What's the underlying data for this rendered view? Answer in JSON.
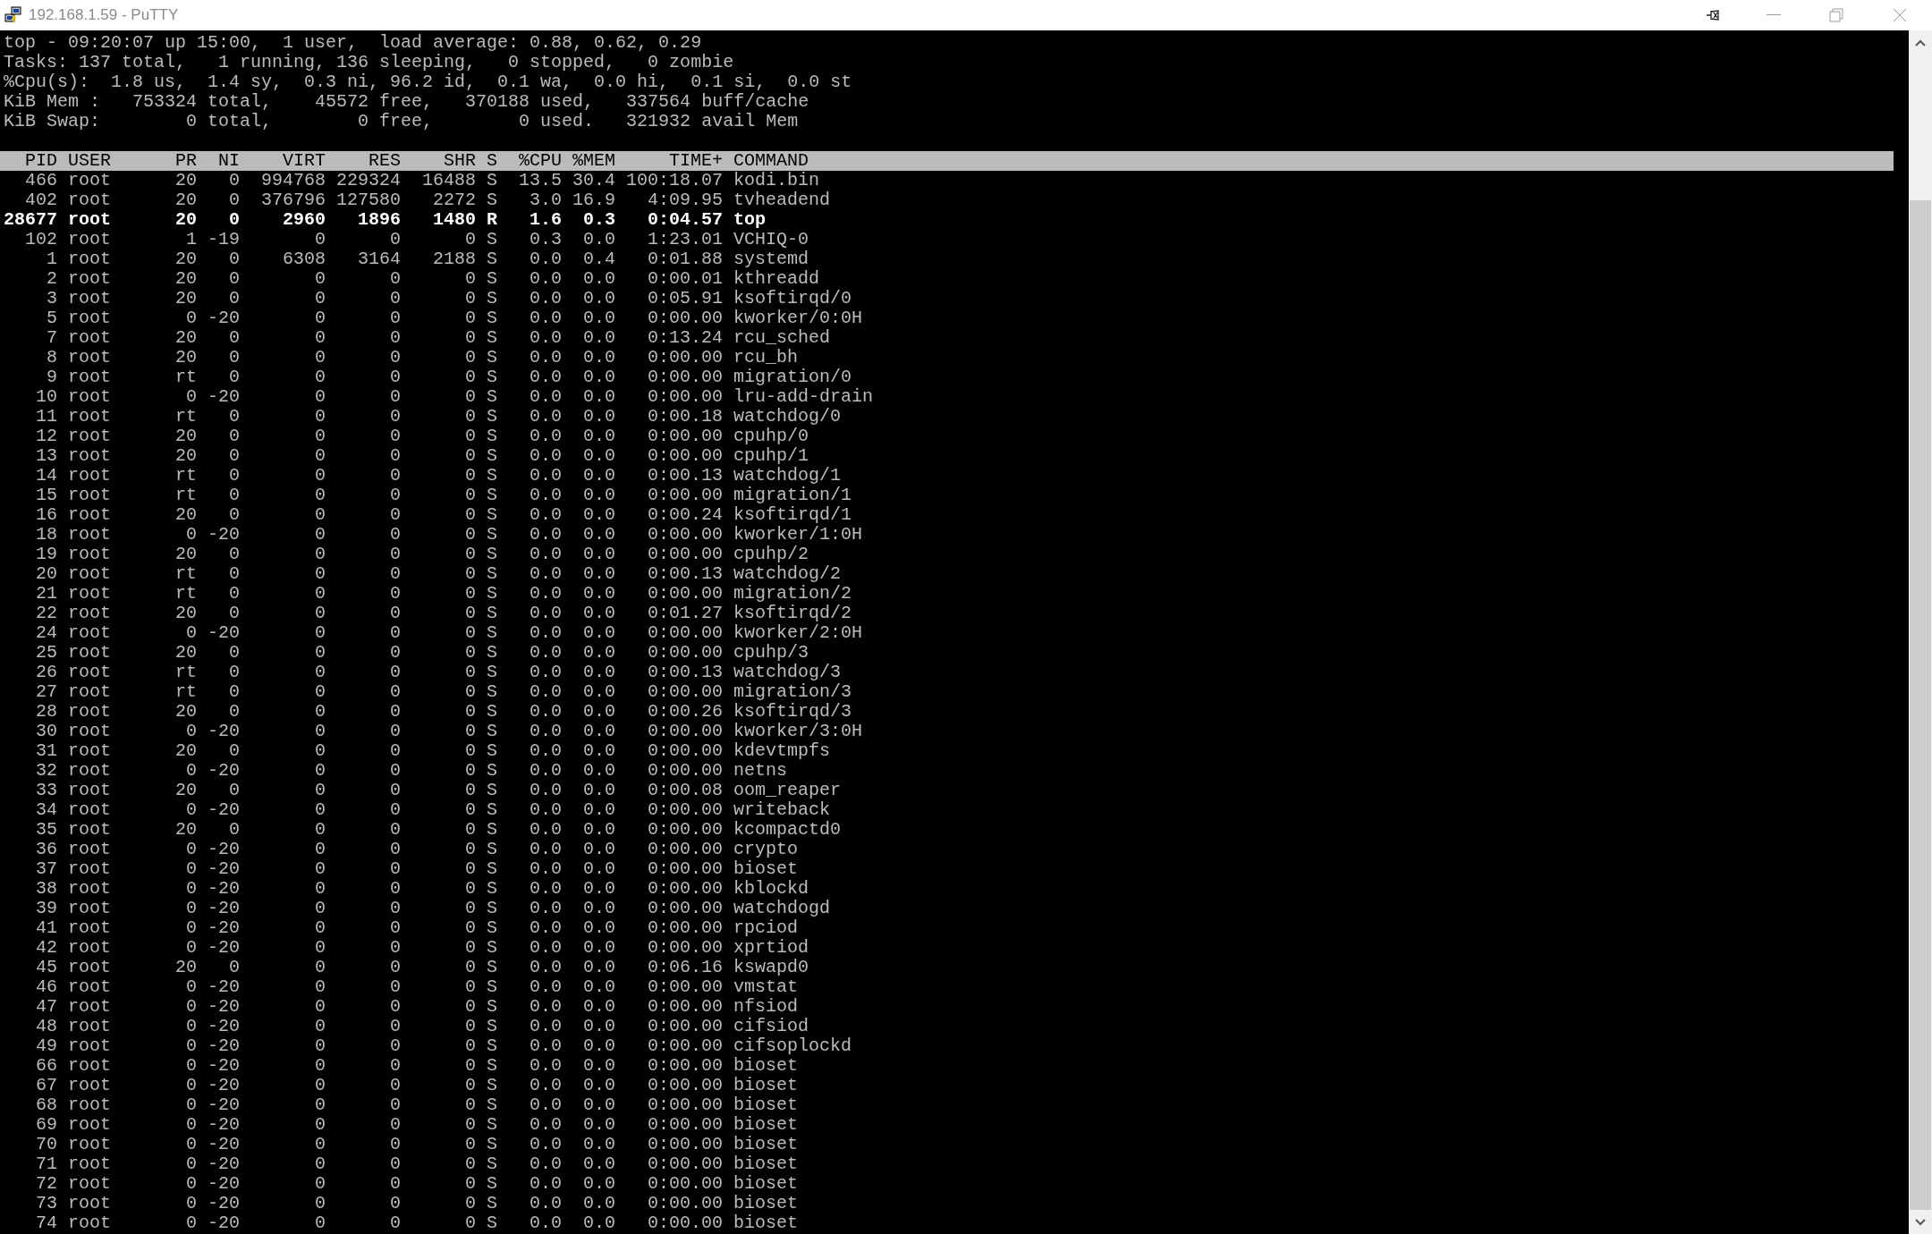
{
  "window": {
    "title": "192.168.1.59 - PuTTY"
  },
  "summary": [
    "top - 09:20:07 up 15:00,  1 user,  load average: 0.88, 0.62, 0.29",
    "Tasks: 137 total,   1 running, 136 sleeping,   0 stopped,   0 zombie",
    "%Cpu(s):  1.8 us,  1.4 sy,  0.3 ni, 96.2 id,  0.1 wa,  0.0 hi,  0.1 si,  0.0 st",
    "KiB Mem :   753324 total,    45572 free,   370188 used,   337564 buff/cache",
    "KiB Swap:        0 total,        0 free,        0 used.   321932 avail Mem"
  ],
  "table": {
    "columns": [
      "PID",
      "USER",
      "PR",
      "NI",
      "VIRT",
      "RES",
      "SHR",
      "S",
      "%CPU",
      "%MEM",
      "TIME+",
      "COMMAND"
    ],
    "rows": [
      {
        "cells": [
          "466",
          "root",
          "20",
          "0",
          "994768",
          "229324",
          "16488",
          "S",
          "13.5",
          "30.4",
          "100:18.07",
          "kodi.bin"
        ],
        "running": false
      },
      {
        "cells": [
          "402",
          "root",
          "20",
          "0",
          "376796",
          "127580",
          "2272",
          "S",
          "3.0",
          "16.9",
          "4:09.95",
          "tvheadend"
        ],
        "running": false
      },
      {
        "cells": [
          "28677",
          "root",
          "20",
          "0",
          "2960",
          "1896",
          "1480",
          "R",
          "1.6",
          "0.3",
          "0:04.57",
          "top"
        ],
        "running": true
      },
      {
        "cells": [
          "102",
          "root",
          "1",
          "-19",
          "0",
          "0",
          "0",
          "S",
          "0.3",
          "0.0",
          "1:23.01",
          "VCHIQ-0"
        ],
        "running": false
      },
      {
        "cells": [
          "1",
          "root",
          "20",
          "0",
          "6308",
          "3164",
          "2188",
          "S",
          "0.0",
          "0.4",
          "0:01.88",
          "systemd"
        ],
        "running": false
      },
      {
        "cells": [
          "2",
          "root",
          "20",
          "0",
          "0",
          "0",
          "0",
          "S",
          "0.0",
          "0.0",
          "0:00.01",
          "kthreadd"
        ],
        "running": false
      },
      {
        "cells": [
          "3",
          "root",
          "20",
          "0",
          "0",
          "0",
          "0",
          "S",
          "0.0",
          "0.0",
          "0:05.91",
          "ksoftirqd/0"
        ],
        "running": false
      },
      {
        "cells": [
          "5",
          "root",
          "0",
          "-20",
          "0",
          "0",
          "0",
          "S",
          "0.0",
          "0.0",
          "0:00.00",
          "kworker/0:0H"
        ],
        "running": false
      },
      {
        "cells": [
          "7",
          "root",
          "20",
          "0",
          "0",
          "0",
          "0",
          "S",
          "0.0",
          "0.0",
          "0:13.24",
          "rcu_sched"
        ],
        "running": false
      },
      {
        "cells": [
          "8",
          "root",
          "20",
          "0",
          "0",
          "0",
          "0",
          "S",
          "0.0",
          "0.0",
          "0:00.00",
          "rcu_bh"
        ],
        "running": false
      },
      {
        "cells": [
          "9",
          "root",
          "rt",
          "0",
          "0",
          "0",
          "0",
          "S",
          "0.0",
          "0.0",
          "0:00.00",
          "migration/0"
        ],
        "running": false
      },
      {
        "cells": [
          "10",
          "root",
          "0",
          "-20",
          "0",
          "0",
          "0",
          "S",
          "0.0",
          "0.0",
          "0:00.00",
          "lru-add-drain"
        ],
        "running": false
      },
      {
        "cells": [
          "11",
          "root",
          "rt",
          "0",
          "0",
          "0",
          "0",
          "S",
          "0.0",
          "0.0",
          "0:00.18",
          "watchdog/0"
        ],
        "running": false
      },
      {
        "cells": [
          "12",
          "root",
          "20",
          "0",
          "0",
          "0",
          "0",
          "S",
          "0.0",
          "0.0",
          "0:00.00",
          "cpuhp/0"
        ],
        "running": false
      },
      {
        "cells": [
          "13",
          "root",
          "20",
          "0",
          "0",
          "0",
          "0",
          "S",
          "0.0",
          "0.0",
          "0:00.00",
          "cpuhp/1"
        ],
        "running": false
      },
      {
        "cells": [
          "14",
          "root",
          "rt",
          "0",
          "0",
          "0",
          "0",
          "S",
          "0.0",
          "0.0",
          "0:00.13",
          "watchdog/1"
        ],
        "running": false
      },
      {
        "cells": [
          "15",
          "root",
          "rt",
          "0",
          "0",
          "0",
          "0",
          "S",
          "0.0",
          "0.0",
          "0:00.00",
          "migration/1"
        ],
        "running": false
      },
      {
        "cells": [
          "16",
          "root",
          "20",
          "0",
          "0",
          "0",
          "0",
          "S",
          "0.0",
          "0.0",
          "0:00.24",
          "ksoftirqd/1"
        ],
        "running": false
      },
      {
        "cells": [
          "18",
          "root",
          "0",
          "-20",
          "0",
          "0",
          "0",
          "S",
          "0.0",
          "0.0",
          "0:00.00",
          "kworker/1:0H"
        ],
        "running": false
      },
      {
        "cells": [
          "19",
          "root",
          "20",
          "0",
          "0",
          "0",
          "0",
          "S",
          "0.0",
          "0.0",
          "0:00.00",
          "cpuhp/2"
        ],
        "running": false
      },
      {
        "cells": [
          "20",
          "root",
          "rt",
          "0",
          "0",
          "0",
          "0",
          "S",
          "0.0",
          "0.0",
          "0:00.13",
          "watchdog/2"
        ],
        "running": false
      },
      {
        "cells": [
          "21",
          "root",
          "rt",
          "0",
          "0",
          "0",
          "0",
          "S",
          "0.0",
          "0.0",
          "0:00.00",
          "migration/2"
        ],
        "running": false
      },
      {
        "cells": [
          "22",
          "root",
          "20",
          "0",
          "0",
          "0",
          "0",
          "S",
          "0.0",
          "0.0",
          "0:01.27",
          "ksoftirqd/2"
        ],
        "running": false
      },
      {
        "cells": [
          "24",
          "root",
          "0",
          "-20",
          "0",
          "0",
          "0",
          "S",
          "0.0",
          "0.0",
          "0:00.00",
          "kworker/2:0H"
        ],
        "running": false
      },
      {
        "cells": [
          "25",
          "root",
          "20",
          "0",
          "0",
          "0",
          "0",
          "S",
          "0.0",
          "0.0",
          "0:00.00",
          "cpuhp/3"
        ],
        "running": false
      },
      {
        "cells": [
          "26",
          "root",
          "rt",
          "0",
          "0",
          "0",
          "0",
          "S",
          "0.0",
          "0.0",
          "0:00.13",
          "watchdog/3"
        ],
        "running": false
      },
      {
        "cells": [
          "27",
          "root",
          "rt",
          "0",
          "0",
          "0",
          "0",
          "S",
          "0.0",
          "0.0",
          "0:00.00",
          "migration/3"
        ],
        "running": false
      },
      {
        "cells": [
          "28",
          "root",
          "20",
          "0",
          "0",
          "0",
          "0",
          "S",
          "0.0",
          "0.0",
          "0:00.26",
          "ksoftirqd/3"
        ],
        "running": false
      },
      {
        "cells": [
          "30",
          "root",
          "0",
          "-20",
          "0",
          "0",
          "0",
          "S",
          "0.0",
          "0.0",
          "0:00.00",
          "kworker/3:0H"
        ],
        "running": false
      },
      {
        "cells": [
          "31",
          "root",
          "20",
          "0",
          "0",
          "0",
          "0",
          "S",
          "0.0",
          "0.0",
          "0:00.00",
          "kdevtmpfs"
        ],
        "running": false
      },
      {
        "cells": [
          "32",
          "root",
          "0",
          "-20",
          "0",
          "0",
          "0",
          "S",
          "0.0",
          "0.0",
          "0:00.00",
          "netns"
        ],
        "running": false
      },
      {
        "cells": [
          "33",
          "root",
          "20",
          "0",
          "0",
          "0",
          "0",
          "S",
          "0.0",
          "0.0",
          "0:00.08",
          "oom_reaper"
        ],
        "running": false
      },
      {
        "cells": [
          "34",
          "root",
          "0",
          "-20",
          "0",
          "0",
          "0",
          "S",
          "0.0",
          "0.0",
          "0:00.00",
          "writeback"
        ],
        "running": false
      },
      {
        "cells": [
          "35",
          "root",
          "20",
          "0",
          "0",
          "0",
          "0",
          "S",
          "0.0",
          "0.0",
          "0:00.00",
          "kcompactd0"
        ],
        "running": false
      },
      {
        "cells": [
          "36",
          "root",
          "0",
          "-20",
          "0",
          "0",
          "0",
          "S",
          "0.0",
          "0.0",
          "0:00.00",
          "crypto"
        ],
        "running": false
      },
      {
        "cells": [
          "37",
          "root",
          "0",
          "-20",
          "0",
          "0",
          "0",
          "S",
          "0.0",
          "0.0",
          "0:00.00",
          "bioset"
        ],
        "running": false
      },
      {
        "cells": [
          "38",
          "root",
          "0",
          "-20",
          "0",
          "0",
          "0",
          "S",
          "0.0",
          "0.0",
          "0:00.00",
          "kblockd"
        ],
        "running": false
      },
      {
        "cells": [
          "39",
          "root",
          "0",
          "-20",
          "0",
          "0",
          "0",
          "S",
          "0.0",
          "0.0",
          "0:00.00",
          "watchdogd"
        ],
        "running": false
      },
      {
        "cells": [
          "41",
          "root",
          "0",
          "-20",
          "0",
          "0",
          "0",
          "S",
          "0.0",
          "0.0",
          "0:00.00",
          "rpciod"
        ],
        "running": false
      },
      {
        "cells": [
          "42",
          "root",
          "0",
          "-20",
          "0",
          "0",
          "0",
          "S",
          "0.0",
          "0.0",
          "0:00.00",
          "xprtiod"
        ],
        "running": false
      },
      {
        "cells": [
          "45",
          "root",
          "20",
          "0",
          "0",
          "0",
          "0",
          "S",
          "0.0",
          "0.0",
          "0:06.16",
          "kswapd0"
        ],
        "running": false
      },
      {
        "cells": [
          "46",
          "root",
          "0",
          "-20",
          "0",
          "0",
          "0",
          "S",
          "0.0",
          "0.0",
          "0:00.00",
          "vmstat"
        ],
        "running": false
      },
      {
        "cells": [
          "47",
          "root",
          "0",
          "-20",
          "0",
          "0",
          "0",
          "S",
          "0.0",
          "0.0",
          "0:00.00",
          "nfsiod"
        ],
        "running": false
      },
      {
        "cells": [
          "48",
          "root",
          "0",
          "-20",
          "0",
          "0",
          "0",
          "S",
          "0.0",
          "0.0",
          "0:00.00",
          "cifsiod"
        ],
        "running": false
      },
      {
        "cells": [
          "49",
          "root",
          "0",
          "-20",
          "0",
          "0",
          "0",
          "S",
          "0.0",
          "0.0",
          "0:00.00",
          "cifsoplockd"
        ],
        "running": false
      },
      {
        "cells": [
          "66",
          "root",
          "0",
          "-20",
          "0",
          "0",
          "0",
          "S",
          "0.0",
          "0.0",
          "0:00.00",
          "bioset"
        ],
        "running": false
      },
      {
        "cells": [
          "67",
          "root",
          "0",
          "-20",
          "0",
          "0",
          "0",
          "S",
          "0.0",
          "0.0",
          "0:00.00",
          "bioset"
        ],
        "running": false
      },
      {
        "cells": [
          "68",
          "root",
          "0",
          "-20",
          "0",
          "0",
          "0",
          "S",
          "0.0",
          "0.0",
          "0:00.00",
          "bioset"
        ],
        "running": false
      },
      {
        "cells": [
          "69",
          "root",
          "0",
          "-20",
          "0",
          "0",
          "0",
          "S",
          "0.0",
          "0.0",
          "0:00.00",
          "bioset"
        ],
        "running": false
      },
      {
        "cells": [
          "70",
          "root",
          "0",
          "-20",
          "0",
          "0",
          "0",
          "S",
          "0.0",
          "0.0",
          "0:00.00",
          "bioset"
        ],
        "running": false
      },
      {
        "cells": [
          "71",
          "root",
          "0",
          "-20",
          "0",
          "0",
          "0",
          "S",
          "0.0",
          "0.0",
          "0:00.00",
          "bioset"
        ],
        "running": false
      },
      {
        "cells": [
          "72",
          "root",
          "0",
          "-20",
          "0",
          "0",
          "0",
          "S",
          "0.0",
          "0.0",
          "0:00.00",
          "bioset"
        ],
        "running": false
      },
      {
        "cells": [
          "73",
          "root",
          "0",
          "-20",
          "0",
          "0",
          "0",
          "S",
          "0.0",
          "0.0",
          "0:00.00",
          "bioset"
        ],
        "running": false
      },
      {
        "cells": [
          "74",
          "root",
          "0",
          "-20",
          "0",
          "0",
          "0",
          "S",
          "0.0",
          "0.0",
          "0:00.00",
          "bioset"
        ],
        "running": false
      }
    ]
  }
}
